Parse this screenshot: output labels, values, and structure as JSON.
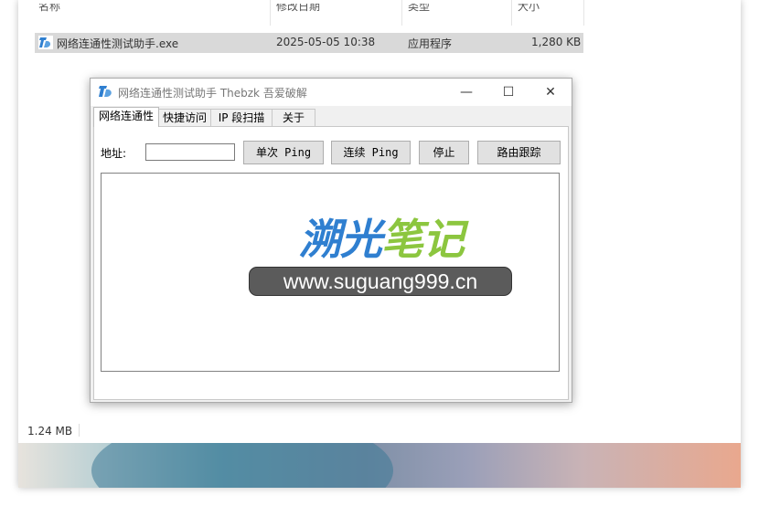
{
  "explorer": {
    "columns": [
      {
        "label": "名称"
      },
      {
        "label": "修改日期"
      },
      {
        "label": "类型"
      },
      {
        "label": "大小"
      }
    ],
    "file": {
      "name": "网络连通性测试助手.exe",
      "modified": "2025-05-05 10:38",
      "type": "应用程序",
      "size": "1,280 KB"
    },
    "status": "1.24 MB"
  },
  "app": {
    "title": "网络连通性测试助手  Thebzk 吾爱破解",
    "window_buttons": {
      "minimize": "—",
      "maximize": "☐",
      "close": "✕"
    },
    "tabs": [
      {
        "label": "网络连通性"
      },
      {
        "label": "快捷访问"
      },
      {
        "label": "IP 段扫描"
      },
      {
        "label": "关于"
      }
    ],
    "address": {
      "label": "地址:",
      "value": "",
      "placeholder": ""
    },
    "buttons": {
      "single_ping": "单次 Ping",
      "continuous_ping": "连续 Ping",
      "stop": "停止",
      "trace_route": "路由跟踪"
    },
    "watermark": {
      "title_part1": "溯光",
      "title_part2": "笔记",
      "url": "www.suguang999.cn"
    }
  },
  "colors": {
    "watermark_blue": "#2f7fd0",
    "watermark_green": "#8cc63f",
    "selection": "#d9d9d9"
  }
}
